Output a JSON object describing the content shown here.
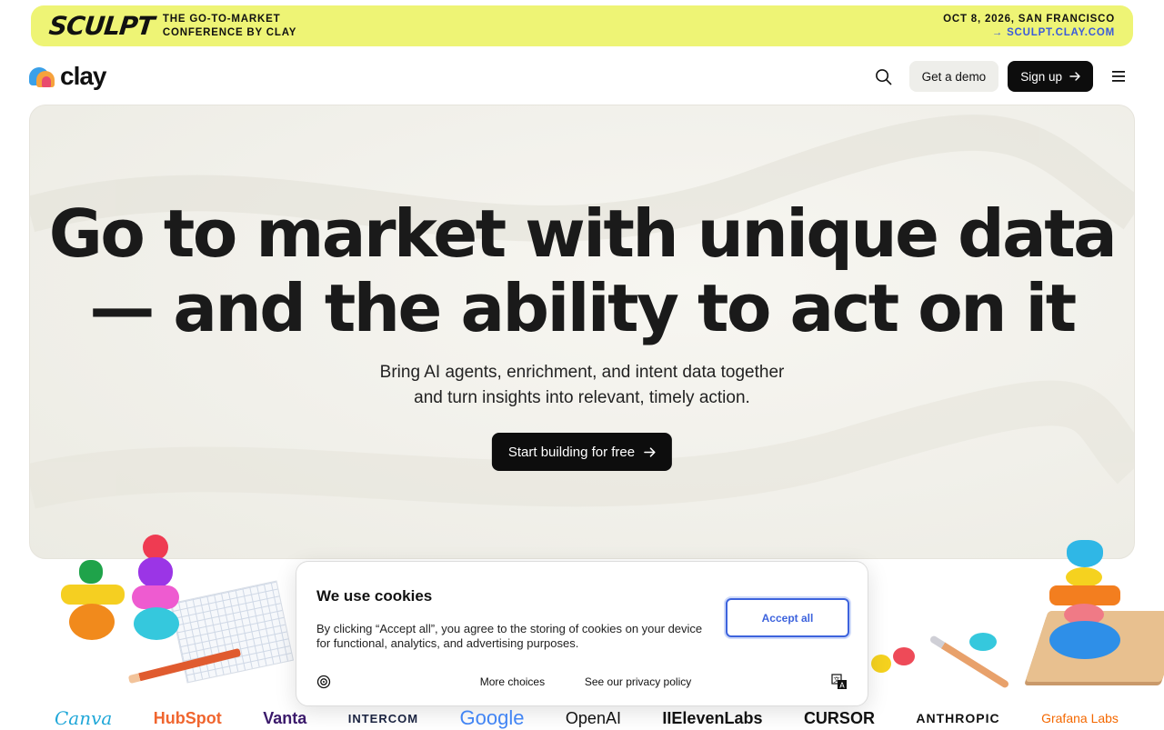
{
  "promo": {
    "logo_text": "SCULPT",
    "subtitle_line1": "THE GO-TO-MARKET",
    "subtitle_line2": "CONFERENCE BY CLAY",
    "event": "OCT 8, 2026, SAN FRANCISCO",
    "link": "→ SCULPT.CLAY.COM",
    "colors": {
      "background": "#eef475",
      "link": "#3b5bdb"
    }
  },
  "nav": {
    "brand": "clay",
    "search_icon": "search-icon",
    "demo_label": "Get a demo",
    "signup_label": "Sign up",
    "menu_icon": "hamburger-menu-icon"
  },
  "hero": {
    "title_line1": "Go to market with unique data",
    "title_line2": "— and the ability to act on it",
    "sub_line1": "Bring AI agents, enrichment, and intent data together",
    "sub_line2": "and turn insights into relevant, timely action.",
    "cta_label": "Start building for free"
  },
  "cookie": {
    "title": "We use cookies",
    "text": "By clicking “Accept all”, you agree to the storing of cookies on your device for functional, analytics, and advertising purposes.",
    "accept_label": "Accept all",
    "more_choices": "More choices",
    "privacy": "See our privacy policy",
    "accent": "#3d63dd"
  },
  "logos": [
    "Canva",
    "HubSpot",
    "Vanta",
    "INTERCOM",
    "Google",
    "OpenAI",
    "IIElevenLabs",
    "CURSOR",
    "ANTHROPIC",
    "Grafana Labs"
  ]
}
